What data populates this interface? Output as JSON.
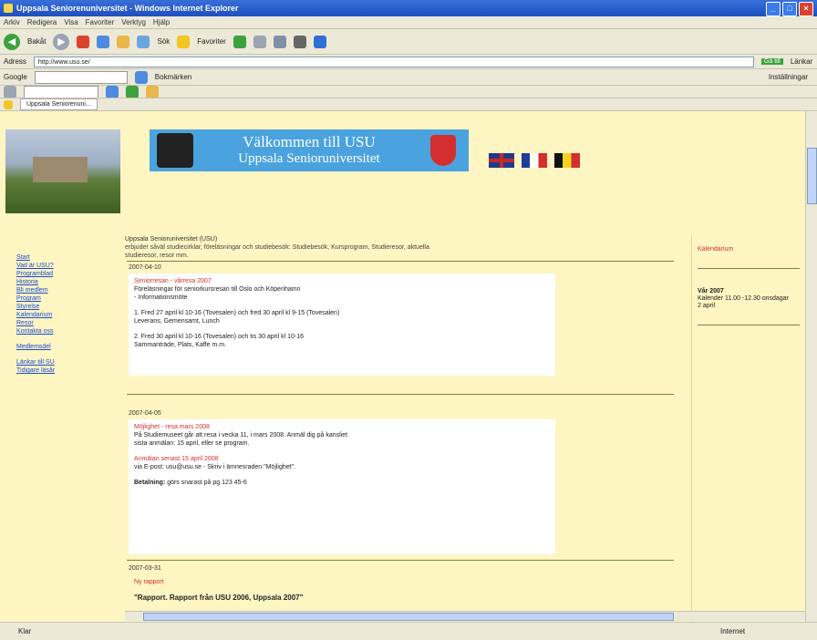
{
  "window": {
    "title": "Uppsala Seniorenuniversitet - Windows Internet Explorer"
  },
  "menu": [
    "Arkiv",
    "Redigera",
    "Visa",
    "Favoriter",
    "Verktyg",
    "Hjälp"
  ],
  "toolbar": {
    "back": "Bakåt",
    "search": "Sök",
    "favorites": "Favoriter"
  },
  "address": {
    "label": "Adress",
    "url": "http://www.usu.se/",
    "go": "Gå till",
    "links": "Länkar"
  },
  "google": {
    "label": "Google",
    "bookmarks": "Bokmärken",
    "settings": "Inställningar"
  },
  "tab": {
    "label": "Uppsala Seniorenuni..."
  },
  "header": {
    "banner_line1": "Välkommen till USU",
    "banner_line2": "Uppsala Senioruniversitet"
  },
  "nav": {
    "items": [
      "Start",
      "Vad är USU?",
      "Programblad",
      "Historia",
      "Bli medlem",
      "Program",
      "Styrelse",
      "Kalendarium",
      "Resor",
      "Kontakta oss"
    ],
    "items2": [
      "Medlemsdel"
    ],
    "items3": [
      "Länkar till SU",
      "Tidigare läsår"
    ]
  },
  "intro": {
    "line1": "Uppsala Senioruniversitet (USU)",
    "line2": "erbjuder såväl studiecirklar, föreläsningar och studiebesök: Studiebesök, Kursprogram, Studieresor, aktuella",
    "line3": "studieresor, resor mm."
  },
  "posts": [
    {
      "date": "2007-04-10",
      "heading": "Seniorresan - vårresa 2007",
      "lines": [
        "Föreläsningar för seniorkursresan till Oslo och Köpenhamn",
        "- Informationsmöte"
      ],
      "p2": "1. Fred 27 april kl 10-16 (Tovesalen) och fred 30 april kl 9-15 (Tovesalen)",
      "p2b": "Leverans, Gemensamt, Lunch",
      "p3": "2. Fred 30 april kl 10-16 (Tovesalen) och tis 30 april kl 10-16",
      "p3b": "Sammanträde, Plats, Kaffe m.m."
    },
    {
      "date": "2007-04-05",
      "heading": "Möjlighet - resa mars 2008",
      "line1": "På Studiemuseet går att resa i vecka 11, i mars 2008. Anmäl dig på kansliet",
      "line2": "sista anmälan: 15 april, eller se program.",
      "heading2": "Anmälan senast 15 april 2008",
      "line3": "via E-post: usu@usu.se - Skriv i ämnesraden \"Möjlighet\".",
      "label": "Betalning:",
      "line4": "görs snarast på pg 123 45-6"
    },
    {
      "date": "2007-03-31",
      "heading": "Ny rapport",
      "title": "\"Rapport. Rapport från USU 2006, Uppsala 2007\""
    }
  ],
  "right": {
    "heading": "Kalendarium",
    "box_title": "Vår 2007",
    "box_l1": "Kalender 11.00 -12.30 onsdagar",
    "box_l2": "2 april"
  },
  "status": {
    "left": "Klar",
    "zone": "Internet"
  }
}
